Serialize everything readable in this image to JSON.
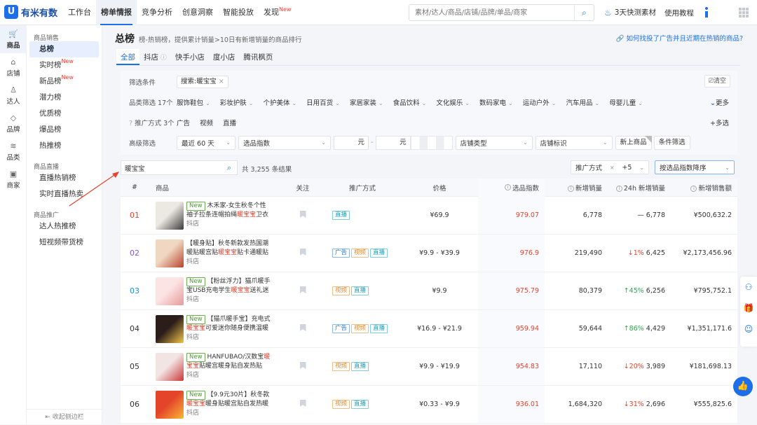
{
  "brand": {
    "name": "有米有数",
    "mark": "U"
  },
  "topnav": [
    {
      "label": "工作台"
    },
    {
      "label": "榜单情报",
      "active": true
    },
    {
      "label": "竞争分析"
    },
    {
      "label": "创意洞察"
    },
    {
      "label": "智能投放"
    },
    {
      "label": "发现",
      "badge": "New"
    }
  ],
  "search": {
    "placeholder": "素材/达人/商品/店铺/品牌/单品/商家"
  },
  "hot_link": "3天快测素材",
  "tutorial": "使用教程",
  "sidenav": [
    {
      "label": "商品",
      "icon": "cart-icon",
      "glyph": "🛒",
      "active": true
    },
    {
      "label": "店铺",
      "icon": "store-icon",
      "glyph": "⌂"
    },
    {
      "label": "达人",
      "icon": "person-icon",
      "glyph": "♙"
    },
    {
      "label": "品牌",
      "icon": "diamond-icon",
      "glyph": "◇"
    },
    {
      "label": "品类",
      "icon": "layers-icon",
      "glyph": "≋"
    },
    {
      "label": "商家",
      "icon": "shop-icon",
      "glyph": "▣"
    }
  ],
  "subnav": {
    "groups": [
      {
        "title": "商品销售",
        "items": [
          {
            "label": "总榜",
            "active": true
          },
          {
            "label": "实时榜",
            "badge": "New"
          },
          {
            "label": "新品榜",
            "badge": "New"
          },
          {
            "label": "潜力榜"
          },
          {
            "label": "优质榜"
          },
          {
            "label": "爆品榜"
          },
          {
            "label": "热推榜"
          }
        ]
      },
      {
        "title": "商品直播",
        "items": [
          {
            "label": "直播热销榜"
          },
          {
            "label": "实时直播热卖"
          }
        ]
      },
      {
        "title": "商品推广",
        "items": [
          {
            "label": "达人热推榜"
          },
          {
            "label": "短视频带货榜"
          }
        ]
      }
    ],
    "collapse_label": "收起侧边栏"
  },
  "page": {
    "title": "总榜",
    "desc": "榜-热销榜，提供累计销量>10日有新增销量的商品排行",
    "help": "如何找投了广告并且近期在热销的商品?"
  },
  "platform_tabs": [
    {
      "label": "全部",
      "active": true
    },
    {
      "label": "抖店",
      "info": true
    },
    {
      "label": "快手小店"
    },
    {
      "label": "度小店"
    },
    {
      "label": "腾讯枫页"
    }
  ],
  "filters": {
    "condition_label": "筛选条件",
    "condition_chip": "搜索:暖宝宝",
    "clear": "清空",
    "category_label": "品类筛选 17个",
    "categories": [
      "服饰鞋包",
      "彩妆护肤",
      "个护美体",
      "日用百货",
      "家居家装",
      "食品饮料",
      "文化娱乐",
      "数码家电",
      "运动户外",
      "汽车用品",
      "母婴儿童"
    ],
    "more": "更多",
    "promo_label": "推广方式 3个",
    "promo_modes": [
      "广告",
      "视频",
      "直播"
    ],
    "multi": "多选",
    "adv_label": "高级筛选",
    "period": "最近 60 天",
    "index_placeholder": "选品指数",
    "unit_yuan": "元",
    "store_type": "店铺类型",
    "store_mark": "店铺标识",
    "new_product": "新上商品",
    "condition_filter": "条件筛选"
  },
  "result": {
    "keyword": "暖宝宝",
    "count_text": "共 3,255 条结果",
    "promo_sort": "推广方式",
    "plus": "+5",
    "sort": "按选品指数降序"
  },
  "table": {
    "headers": {
      "idx": "#",
      "product": "商品",
      "fav": "关注",
      "mode": "推广方式",
      "price": "价格",
      "score": "选品指数",
      "new_sales": "新增销量",
      "sales_24h": "24h 新增销量",
      "amount": "新增销售额"
    },
    "rows": [
      {
        "rank": "01",
        "rank_color": "r-red",
        "thumb": [
          "#ece9e3",
          "#3b3a38"
        ],
        "is_new": true,
        "name_a": "木禾家-女生秋冬个性袖子拉条连帽拍绳",
        "name_hl": "暖宝宝",
        "name_b": "卫衣",
        "shop": "抖店",
        "modes": [
          {
            "t": "直播",
            "k": "live"
          }
        ],
        "price": "¥69.9",
        "score": "979.07",
        "new_sales": "6,778",
        "trend": "flat",
        "trend_pct": "",
        "sales_24h": "6,778",
        "amount": "¥500,632.2"
      },
      {
        "rank": "02",
        "rank_color": "r-purple",
        "thumb": [
          "#f0d7c1",
          "#b8432a"
        ],
        "is_new": false,
        "name_a": "【暖身贴】秋冬新款发热国潮暖贴暖宫贴",
        "name_hl": "暖宝宝",
        "name_b": "贴卡通暖贴保...",
        "shop": "抖店",
        "modes": [
          {
            "t": "广告",
            "k": "ad"
          },
          {
            "t": "视频",
            "k": "video"
          },
          {
            "t": "直播",
            "k": "live"
          }
        ],
        "price": "¥9.9 - ¥39.9",
        "score": "976.9",
        "new_sales": "219,490",
        "trend": "down",
        "trend_pct": "1%",
        "sales_24h": "6,425",
        "amount": "¥2,173,456.96"
      },
      {
        "rank": "03",
        "rank_color": "r-blue",
        "thumb": [
          "#fde4e4",
          "#e59a9a"
        ],
        "is_new": true,
        "name_a": "【粉丝浮力】猫爪暖手宝USB充电学生",
        "name_hl": "暖宝宝",
        "name_b": "送礼迷你...",
        "shop": "抖店",
        "modes": [
          {
            "t": "视频",
            "k": "video"
          },
          {
            "t": "直播",
            "k": "live"
          }
        ],
        "price": "¥9.9",
        "score": "975.79",
        "new_sales": "80,379",
        "trend": "up",
        "trend_pct": "45%",
        "sales_24h": "6,256",
        "amount": "¥795,752.1"
      },
      {
        "rank": "04",
        "rank_color": "r-dark",
        "thumb": [
          "#2a1d1a",
          "#f4c64a"
        ],
        "is_new": true,
        "name_a": "【猫爪暖手宝】充电式",
        "name_hl": "暖宝宝",
        "name_b": "可爱迷你随身便携温暖女...",
        "shop": "抖店",
        "modes": [
          {
            "t": "广告",
            "k": "ad"
          },
          {
            "t": "视频",
            "k": "video"
          },
          {
            "t": "直播",
            "k": "live"
          }
        ],
        "price": "¥16.9 - ¥21.9",
        "score": "959.94",
        "new_sales": "59,644",
        "trend": "up",
        "trend_pct": "86%",
        "sales_24h": "4,429",
        "amount": "¥1,351,171.6"
      },
      {
        "rank": "05",
        "rank_color": "r-dark",
        "thumb": [
          "#f3e4e4",
          "#c9383a"
        ],
        "is_new": true,
        "name_a": "HANFUBAO/汉数宝",
        "name_hl": "暖宝宝",
        "name_b": "贴暖宫暖身贴自发热贴大...",
        "shop": "抖店",
        "modes": [
          {
            "t": "视频",
            "k": "video"
          },
          {
            "t": "直播",
            "k": "live"
          }
        ],
        "price": "¥9.9 - ¥19.9",
        "score": "954.83",
        "new_sales": "17,110",
        "trend": "down",
        "trend_pct": "20%",
        "sales_24h": "3,989",
        "amount": "¥181,698.13"
      },
      {
        "rank": "06",
        "rank_color": "r-dark",
        "thumb": [
          "#e4452a",
          "#f7b733"
        ],
        "is_new": true,
        "name_a": "【9.9元30片】秋冬款",
        "name_hl": "暖宝宝",
        "name_b": "暖身贴暖宫贴自发热暖衣...",
        "shop": "抖店",
        "modes": [
          {
            "t": "视频",
            "k": "video"
          },
          {
            "t": "直播",
            "k": "live"
          }
        ],
        "price": "¥0.33 - ¥9.9",
        "score": "936.01",
        "new_sales": "1,684,320",
        "trend": "down",
        "trend_pct": "31%",
        "sales_24h": "2,696",
        "amount": "¥555,825.6"
      }
    ]
  },
  "colors": {
    "accent": "#1c6fe8",
    "highlight": "#e8412c",
    "up": "#2aa84a",
    "arrow": "#e8412c"
  }
}
